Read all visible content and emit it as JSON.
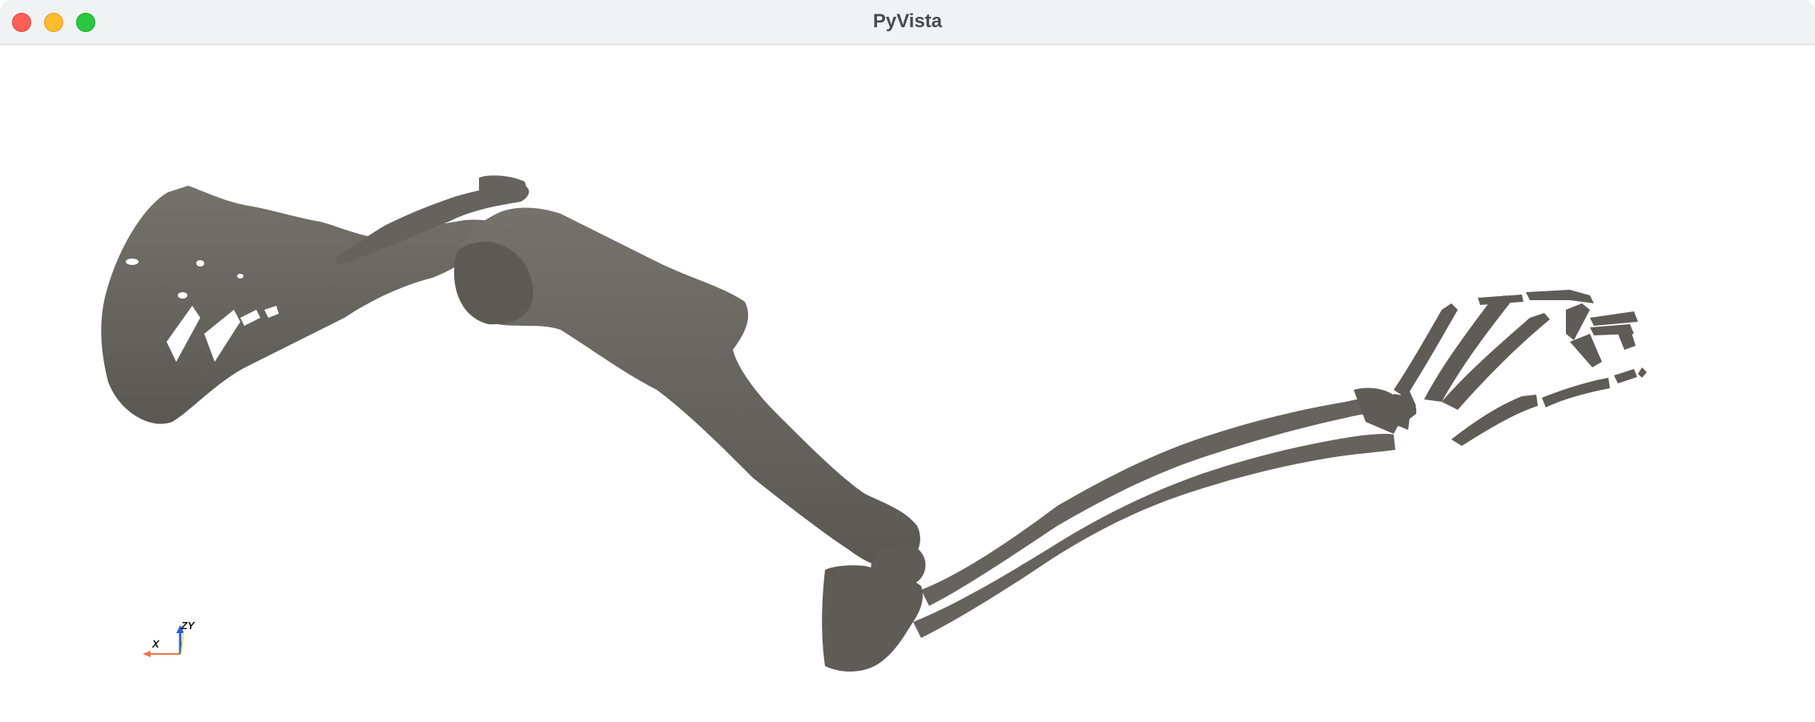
{
  "window": {
    "title": "PyVista",
    "controls": {
      "close": "close",
      "minimize": "minimize",
      "zoom": "zoom"
    },
    "colors": {
      "close": "#ff5f57",
      "minimize": "#febc2e",
      "zoom": "#28c840",
      "titlebar": "#f1f2f4"
    }
  },
  "scene": {
    "background": "#ffffff",
    "mesh_color": "#66635e",
    "mesh_description_icon": "bone-mesh"
  },
  "orientation_widget": {
    "x_label": "X",
    "y_label": "Y",
    "z_label": "Z",
    "x_color": "#e8764a",
    "y_color": "#e8e043",
    "z_color": "#2a5ee0"
  }
}
